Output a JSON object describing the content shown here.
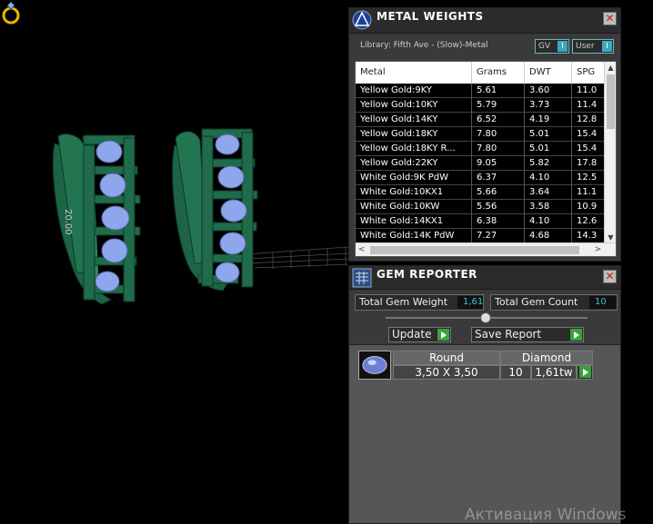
{
  "viewport": {
    "dimension_label": "20.00",
    "metal_color": "#1f6b4b",
    "gem_color": "#8fa8ee"
  },
  "metal_weights": {
    "title": "METAL WEIGHTS",
    "icon": "blue-triangle-logo-icon",
    "close_label": "✕",
    "library_label": "Library: Fifth Ave - (Slow)-Metal",
    "toggle_gv": "GV",
    "toggle_user": "User",
    "toggle_knob": "I",
    "columns": [
      "Metal",
      "Grams",
      "DWT",
      "SPG"
    ],
    "rows": [
      {
        "metal": "Yellow Gold:9KY",
        "grams": "5.61",
        "dwt": "3.60",
        "spg": "11.0"
      },
      {
        "metal": "Yellow Gold:10KY",
        "grams": "5.79",
        "dwt": "3.73",
        "spg": "11.4"
      },
      {
        "metal": "Yellow Gold:14KY",
        "grams": "6.52",
        "dwt": "4.19",
        "spg": "12.8"
      },
      {
        "metal": "Yellow Gold:18KY",
        "grams": "7.80",
        "dwt": "5.01",
        "spg": "15.4"
      },
      {
        "metal": "Yellow Gold:18KY R...",
        "grams": "7.80",
        "dwt": "5.01",
        "spg": "15.4"
      },
      {
        "metal": "Yellow Gold:22KY",
        "grams": "9.05",
        "dwt": "5.82",
        "spg": "17.8"
      },
      {
        "metal": "White Gold:9K PdW",
        "grams": "6.37",
        "dwt": "4.10",
        "spg": "12.5"
      },
      {
        "metal": "White Gold:10KX1",
        "grams": "5.66",
        "dwt": "3.64",
        "spg": "11.1"
      },
      {
        "metal": "White Gold:10KW",
        "grams": "5.56",
        "dwt": "3.58",
        "spg": "10.9"
      },
      {
        "metal": "White Gold:14KX1",
        "grams": "6.38",
        "dwt": "4.10",
        "spg": "12.6"
      },
      {
        "metal": "White Gold:14K PdW",
        "grams": "7.27",
        "dwt": "4.68",
        "spg": "14.3"
      }
    ]
  },
  "gem_reporter": {
    "title": "GEM REPORTER",
    "icon": "report-grid-icon",
    "close_label": "✕",
    "total_weight_label": "Total Gem Weight",
    "total_weight_value": "1,61",
    "total_count_label": "Total Gem Count",
    "total_count_value": "10",
    "update_label": "Update",
    "save_report_label": "Save Report",
    "gem": {
      "shape": "Round",
      "type": "Diamond",
      "size": "3,50 X 3,50",
      "count": "10",
      "weight": "1,61tw"
    }
  },
  "watermark": "Активация Windows"
}
